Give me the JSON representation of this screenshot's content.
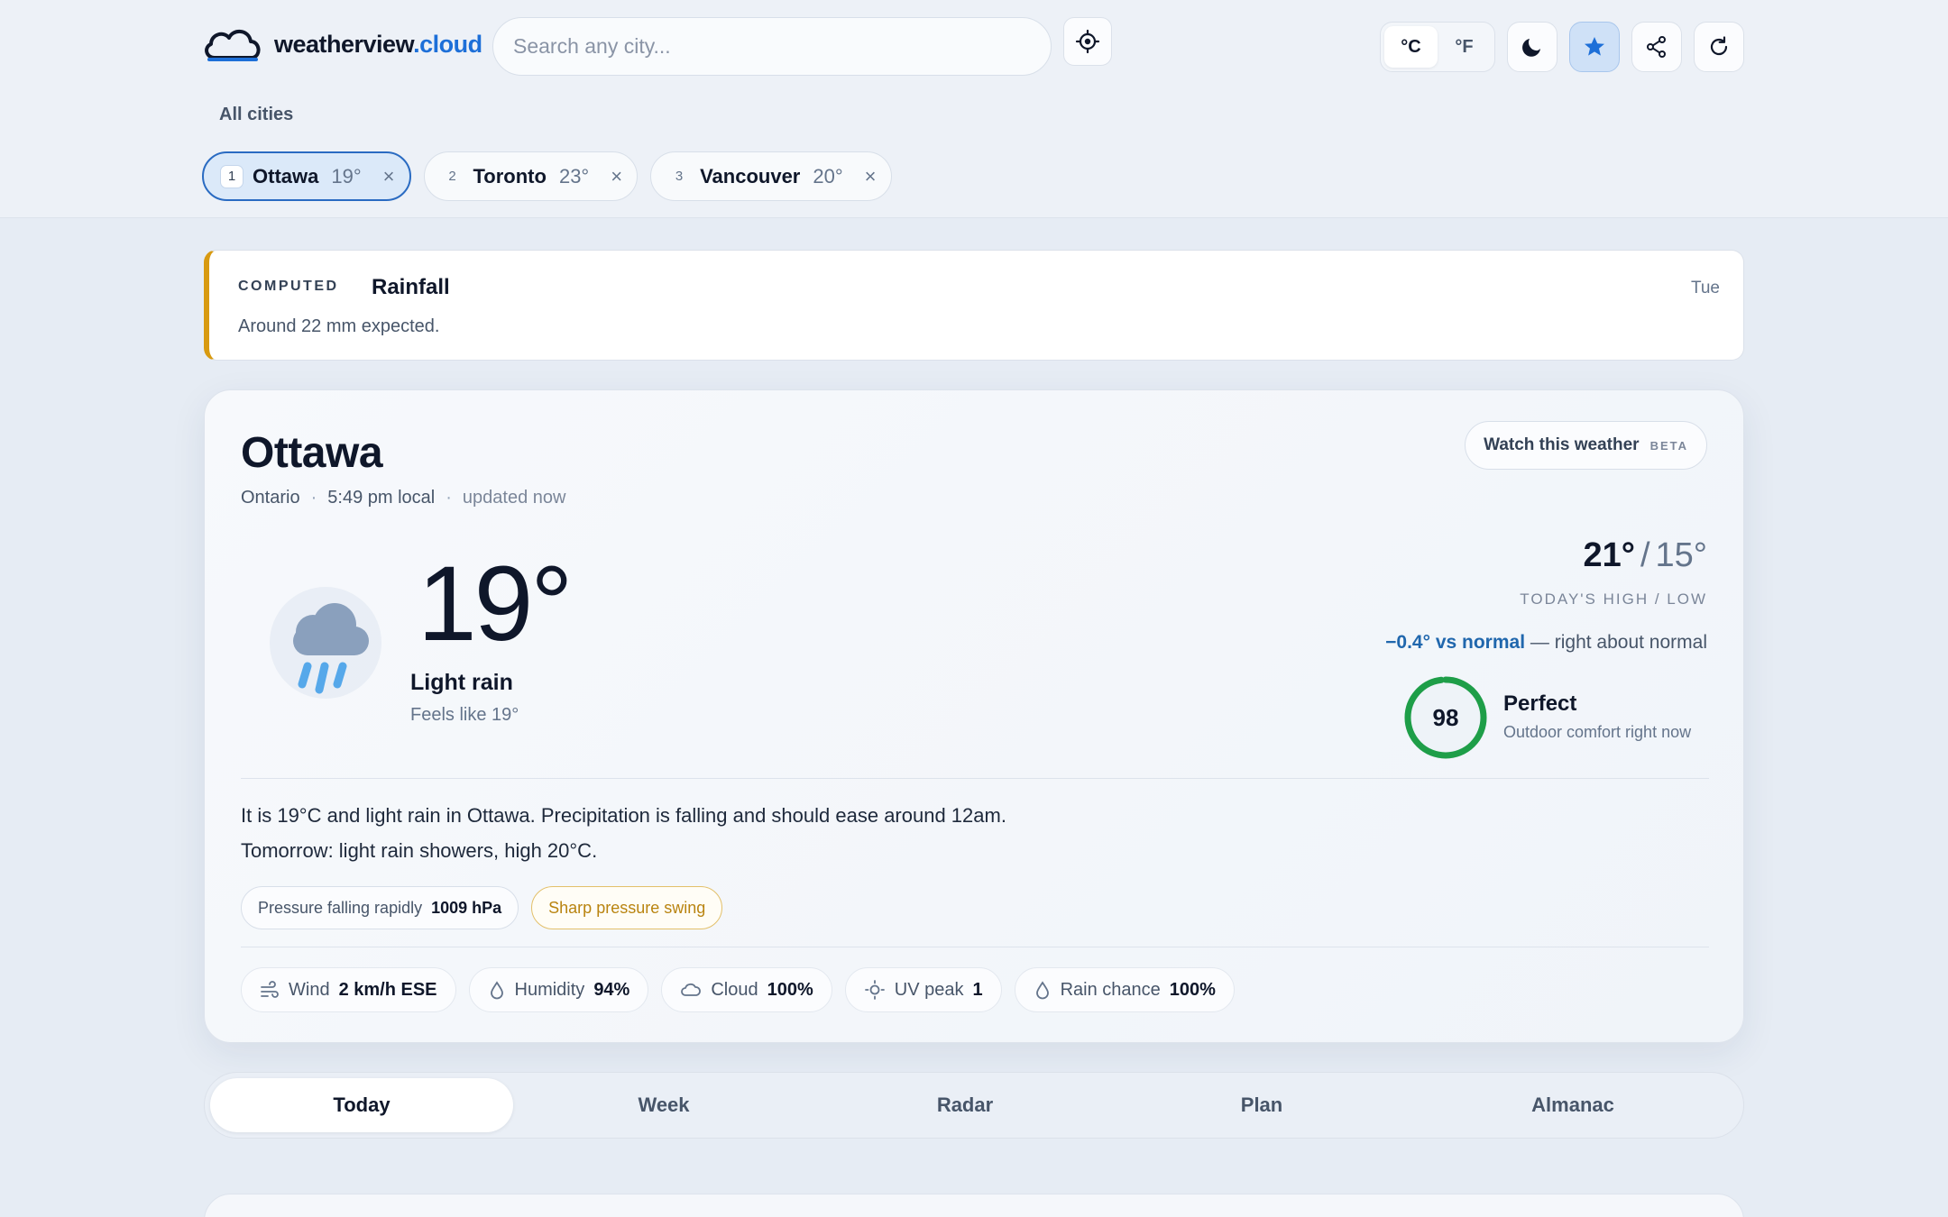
{
  "header": {
    "logo_name": "weatherview",
    "logo_tld": ".cloud",
    "search_placeholder": "Search any city...",
    "units": [
      "°C",
      "°F"
    ],
    "active_unit": "°C",
    "icons": [
      "locate-icon",
      "moon-icon",
      "star-icon",
      "share-icon",
      "refresh-icon"
    ],
    "accent_color": "#1d6fd8"
  },
  "cities": {
    "label": "All cities",
    "chips": [
      {
        "num": "1",
        "name": "Ottawa",
        "temp": "19°",
        "close": "×"
      },
      {
        "num": "2",
        "name": "Toronto",
        "temp": "23°",
        "close": "×"
      },
      {
        "num": "3",
        "name": "Vancouver",
        "temp": "20°",
        "close": "×"
      }
    ]
  },
  "alert": {
    "tag": "COMPUTED",
    "title": "Rainfall",
    "day": "Tue",
    "text": "Around 22 mm expected.",
    "color": "#d89a10"
  },
  "current": {
    "city": "Ottawa",
    "region": "Ontario",
    "local_time": "5:49 pm local",
    "updated": "updated now",
    "watch_label": "Watch this weather",
    "watch_badge": "BETA",
    "temp": "19°",
    "condition": "Light rain",
    "feels_like": "Feels like 19°",
    "high": "21°",
    "low": "15°",
    "hilo_label": "TODAY'S HIGH / LOW",
    "delta": "−0.4° vs normal",
    "delta_note": "— right about normal",
    "comfort_score": "98",
    "comfort_fraction": 0.98,
    "comfort_title": "Perfect",
    "comfort_sub": "Outdoor comfort right now",
    "summary_line1": "It is 19°C and light rain in Ottawa. Precipitation is falling and should ease around 12am.",
    "summary_line2": "Tomorrow: light rain showers, high 20°C.",
    "pressure_label": "Pressure falling rapidly",
    "pressure_value": "1009 hPa",
    "pressure_warning": "Sharp pressure swing",
    "stats": [
      {
        "icon": "wind-icon",
        "label": "Wind",
        "value": "2 km/h ESE"
      },
      {
        "icon": "humidity-icon",
        "label": "Humidity",
        "value": "94%"
      },
      {
        "icon": "cloud-icon",
        "label": "Cloud",
        "value": "100%"
      },
      {
        "icon": "sun-icon",
        "label": "UV peak",
        "value": "1"
      },
      {
        "icon": "raindrop-icon",
        "label": "Rain chance",
        "value": "100%"
      }
    ]
  },
  "tabs": [
    {
      "label": "Today",
      "active": true
    },
    {
      "label": "Week",
      "active": false
    },
    {
      "label": "Radar",
      "active": false
    },
    {
      "label": "Plan",
      "active": false
    },
    {
      "label": "Almanac",
      "active": false
    }
  ]
}
